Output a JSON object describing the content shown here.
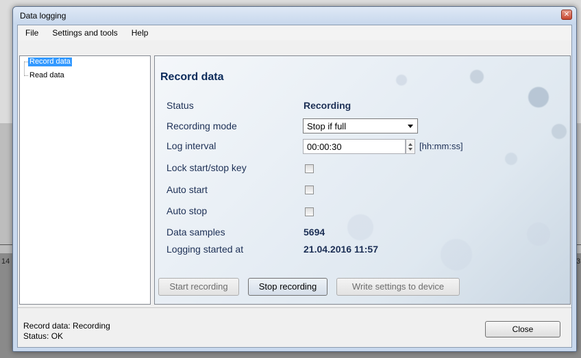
{
  "window": {
    "title": "Data logging"
  },
  "menu": {
    "items": [
      "File",
      "Settings and tools",
      "Help"
    ]
  },
  "tree": {
    "items": [
      {
        "label": "Record data",
        "selected": true
      },
      {
        "label": "Read data",
        "selected": false
      }
    ]
  },
  "panel": {
    "title": "Record data",
    "status_label": "Status",
    "status_value": "Recording",
    "mode_label": "Recording mode",
    "mode_value": "Stop if full",
    "interval_label": "Log interval",
    "interval_value": "00:00:30",
    "interval_unit": "[hh:mm:ss]",
    "lock_label": "Lock start/stop key",
    "lock_checked": false,
    "autostart_label": "Auto start",
    "autostart_checked": false,
    "autostop_label": "Auto stop",
    "autostop_checked": false,
    "samples_label": "Data samples",
    "samples_value": "5694",
    "started_label": "Logging started at",
    "started_value": "21.04.2016 11:57"
  },
  "buttons": {
    "start": "Start recording",
    "stop": "Stop recording",
    "write": "Write settings to device",
    "close": "Close"
  },
  "statusbar": {
    "line1": "Record data: Recording",
    "line2": "Status: OK"
  },
  "background": {
    "left_fragment": "14",
    "right_fragment": "3"
  },
  "colors": {
    "accent_text": "#1c2f55",
    "selection": "#3399ff"
  }
}
